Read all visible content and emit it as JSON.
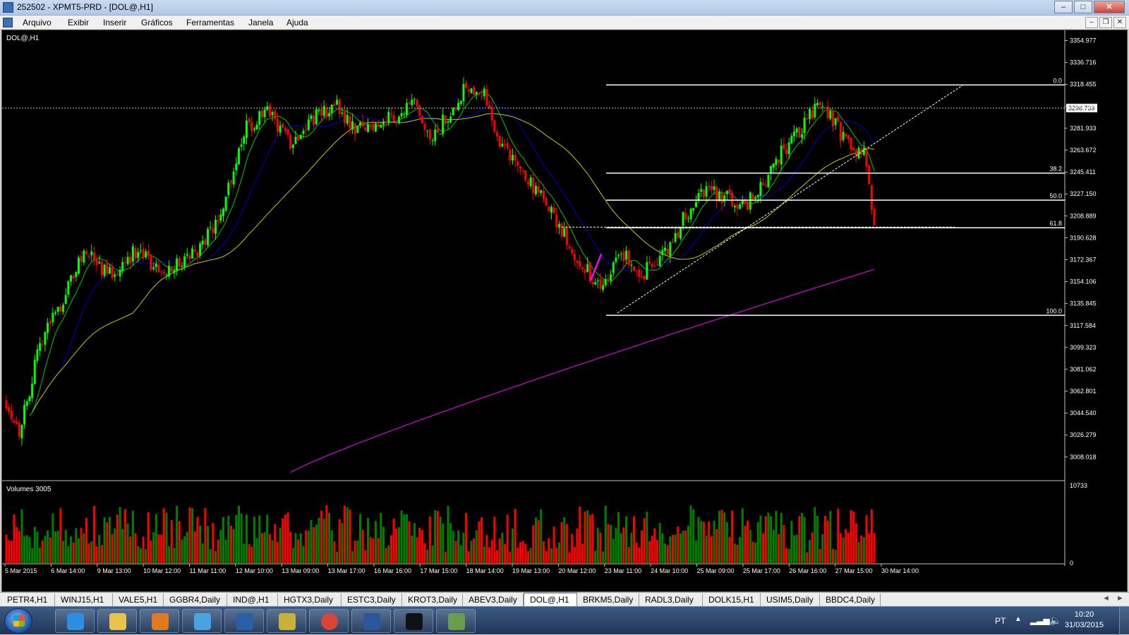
{
  "window": {
    "title": "252502 - XPMT5-PRD - [DOL@,H1]",
    "buttons": {
      "minimize": "–",
      "maximize": "□",
      "close": "✕"
    }
  },
  "menu": [
    "Arquivo",
    "Exibir",
    "Inserir",
    "Gráficos",
    "Ferramentas",
    "Janela",
    "Ajuda"
  ],
  "mdi_buttons": {
    "minimize": "–",
    "restore": "❐",
    "close": "✕"
  },
  "chart": {
    "symbol_label": "DOL@,H1",
    "volume_label": "Volumes 3005",
    "price_ticks": [
      "3354.977",
      "3336.716",
      "3318.455",
      "3300.194",
      "3281.933",
      "3263.672",
      "3245.411",
      "3227.150",
      "3208.889",
      "3190.628",
      "3172.367",
      "3154.106",
      "3135.845",
      "3117.584",
      "3099.323",
      "3081.062",
      "3062.801",
      "3044.540",
      "3026.279",
      "3008.018"
    ],
    "price_ylim": [
      2990,
      3360
    ],
    "current_price": "3298.739",
    "volume_ticks": [
      "10733",
      "0"
    ],
    "volume_ylim": [
      0,
      10733
    ],
    "time_labels": [
      "5 Mar 2015",
      "6 Mar 14:00",
      "9 Mar 13:00",
      "10 Mar 12:00",
      "11 Mar 11:00",
      "12 Mar 10:00",
      "13 Mar 09:00",
      "13 Mar 17:00",
      "16 Mar 16:00",
      "17 Mar 15:00",
      "18 Mar 14:00",
      "19 Mar 13:00",
      "20 Mar 12:00",
      "23 Mar 11:00",
      "24 Mar 10:00",
      "25 Mar 09:00",
      "25 Mar 17:00",
      "26 Mar 16:00",
      "27 Mar 15:00",
      "30 Mar 14:00"
    ],
    "fibonacci": [
      {
        "label": "0.0",
        "price": 3318.0
      },
      {
        "label": "38.2",
        "price": 3244.5
      },
      {
        "label": "50.0",
        "price": 3222.0
      },
      {
        "label": "61.8",
        "price": 3199.0
      },
      {
        "label": "100.0",
        "price": 3126.0
      }
    ],
    "colors": {
      "up": "#00ff00",
      "down": "#ff0000",
      "vol_up": "#008000",
      "vol_down": "#ff0000",
      "ma_fast": "#00c800",
      "ma_mid": "#0000c8",
      "ma_slow": "#c8c800",
      "ma_long": "#ff00ff",
      "fib": "#ffffff"
    }
  },
  "tabs": [
    "PETR4,H1",
    "WINJ15,H1",
    "VALE5,H1",
    "GGBR4,Daily",
    "IND@,H1",
    "HGTX3,Daily",
    "ESTC3,Daily",
    "KROT3,Daily",
    "ABEV3,Daily",
    "DOL@,H1",
    "BRKM5,Daily",
    "RADL3,Daily",
    "DOLK15,H1",
    "USIM5,Daily",
    "BBDC4,Daily"
  ],
  "active_tab": "DOL@,H1",
  "tab_nav": {
    "prev": "◄",
    "next": "►"
  },
  "taskbar": {
    "apps": [
      {
        "name": "internet-explorer",
        "color": "#2d8ee0"
      },
      {
        "name": "file-explorer",
        "color": "#e8c24a"
      },
      {
        "name": "media-player",
        "color": "#e07a1e"
      },
      {
        "name": "remote-app",
        "color": "#4aa3e0"
      },
      {
        "name": "hp-utility",
        "color": "#2b5fa8"
      },
      {
        "name": "archive-tool",
        "color": "#c9b037"
      },
      {
        "name": "chrome",
        "color": "#db4437"
      },
      {
        "name": "word",
        "color": "#2b579a"
      },
      {
        "name": "xp-trading",
        "color": "#111111"
      },
      {
        "name": "metatrader",
        "color": "#6a9c4a"
      }
    ],
    "lang": "PT",
    "time": "10:20",
    "date": "31/03/2015"
  }
}
